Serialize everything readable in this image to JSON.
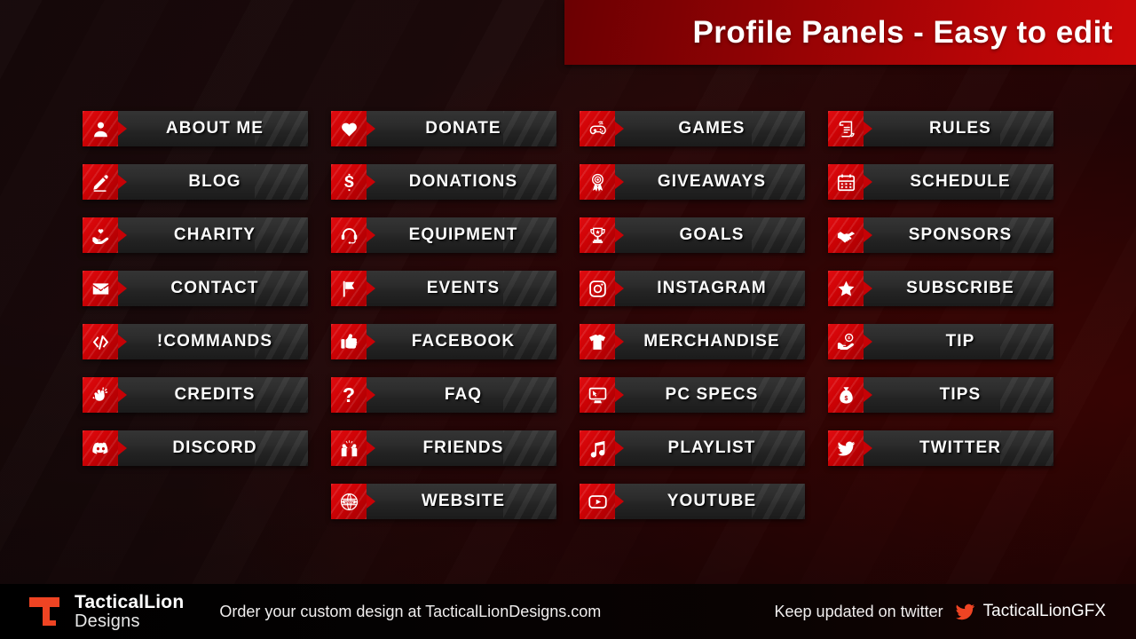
{
  "header": {
    "title": "Profile Panels - Easy to edit"
  },
  "colors": {
    "accent_red": "#c60206",
    "icon_red_light": "#e00d11",
    "panel_body_dark": "#2c2c2c",
    "header_red": "#a50405",
    "logo_orange": "#ef4423",
    "background_dark": "#1a0a0b"
  },
  "columns": [
    {
      "name": "column-1",
      "panels": [
        {
          "label": "ABOUT ME",
          "icon": "user-icon"
        },
        {
          "label": "BLOG",
          "icon": "pencil-icon"
        },
        {
          "label": "CHARITY",
          "icon": "heart-in-hand-icon"
        },
        {
          "label": "CONTACT",
          "icon": "envelope-icon"
        },
        {
          "label": "!COMMANDS",
          "icon": "code-brackets-icon"
        },
        {
          "label": "CREDITS",
          "icon": "clapping-hands-icon"
        },
        {
          "label": "DISCORD",
          "icon": "discord-icon"
        }
      ]
    },
    {
      "name": "column-2",
      "panels": [
        {
          "label": "DONATE",
          "icon": "heart-icon"
        },
        {
          "label": "DONATIONS",
          "icon": "dollar-sign-icon"
        },
        {
          "label": "EQUIPMENT",
          "icon": "headset-icon"
        },
        {
          "label": "EVENTS",
          "icon": "flag-icon"
        },
        {
          "label": "FACEBOOK",
          "icon": "thumbs-up-icon"
        },
        {
          "label": "FAQ",
          "icon": "question-mark-icon"
        },
        {
          "label": "FRIENDS",
          "icon": "two-people-icon"
        },
        {
          "label": "WEBSITE",
          "icon": "globe-www-icon"
        }
      ]
    },
    {
      "name": "column-3",
      "panels": [
        {
          "label": "GAMES",
          "icon": "gamepad-icon"
        },
        {
          "label": "GIVEAWAYS",
          "icon": "award-ribbon-icon"
        },
        {
          "label": "GOALS",
          "icon": "trophy-icon"
        },
        {
          "label": "INSTAGRAM",
          "icon": "instagram-icon"
        },
        {
          "label": "MERCHANDISE",
          "icon": "tshirt-icon"
        },
        {
          "label": "PC SPECS",
          "icon": "monitor-icon"
        },
        {
          "label": "PLAYLIST",
          "icon": "music-note-icon"
        },
        {
          "label": "YOUTUBE",
          "icon": "youtube-icon"
        }
      ]
    },
    {
      "name": "column-4",
      "panels": [
        {
          "label": "RULES",
          "icon": "scroll-icon"
        },
        {
          "label": "SCHEDULE",
          "icon": "calendar-icon"
        },
        {
          "label": "SPONSORS",
          "icon": "handshake-icon"
        },
        {
          "label": "SUBSCRIBE",
          "icon": "star-icon"
        },
        {
          "label": "TIP",
          "icon": "hand-coin-icon"
        },
        {
          "label": "TIPS",
          "icon": "money-bag-icon"
        },
        {
          "label": "TWITTER",
          "icon": "twitter-bird-icon"
        }
      ]
    }
  ],
  "footer": {
    "brand_line1": "TacticalLion",
    "brand_line2": "Designs",
    "order_text": "Order your custom design at TacticalLionDesigns.com",
    "keep_text": "Keep updated on twitter",
    "twitter_handle": "TacticalLionGFX",
    "logo_icon": "tacticallion-logo-icon",
    "twitter_icon": "twitter-bird-icon"
  }
}
